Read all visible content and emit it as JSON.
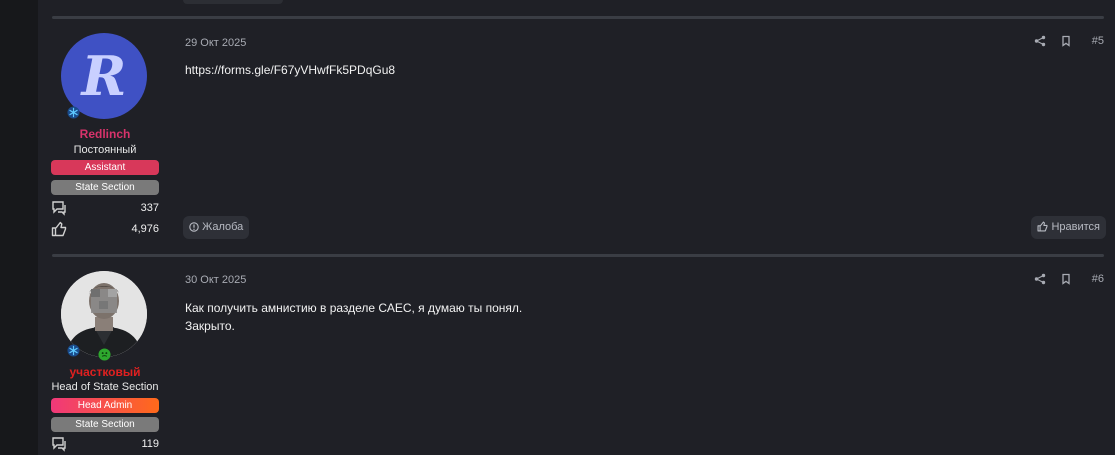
{
  "posts": [
    {
      "username": "Redlinch",
      "username_color": "#d8336b",
      "avatar_letter": "R",
      "user_title": "Постоянный",
      "roles": [
        {
          "label": "Assistant",
          "color": "#d8385a"
        },
        {
          "label": "State Section",
          "color": "#7a7a7a"
        }
      ],
      "messages_count": "337",
      "reactions_count": "4,976",
      "date": "29 Окт 2025",
      "number": "#5",
      "lines": [
        "https://forms.gle/F67yVHwfFk5PDqGu8"
      ],
      "report_label": "Жалоба",
      "like_label": "Нравится"
    },
    {
      "username": "участковый",
      "username_color": "#e02020",
      "user_title": "Head of State Section",
      "roles": [
        {
          "label": "Head Admin",
          "color": "#f0387a"
        },
        {
          "label": "State Section",
          "color": "#7a7a7a"
        }
      ],
      "messages_count": "119",
      "date": "30 Окт 2025",
      "number": "#6",
      "lines": [
        "Как получить амнистию в разделе САЕС, я думаю ты понял.",
        "Закрыто."
      ]
    }
  ],
  "icons": {
    "share": "share-icon",
    "bookmark": "bookmark-icon",
    "messages": "messages-icon",
    "reactions": "thumbs-up-icon",
    "report": "alert-circle-icon",
    "like": "thumbs-up-icon",
    "staff_badge": "snowflake-badge-icon",
    "status_badge": "smiley-badge-icon"
  },
  "colors": {
    "background": "#1f2026",
    "divider": "#3a3d44",
    "head_admin_gradient_end": "#ff6a1a"
  }
}
